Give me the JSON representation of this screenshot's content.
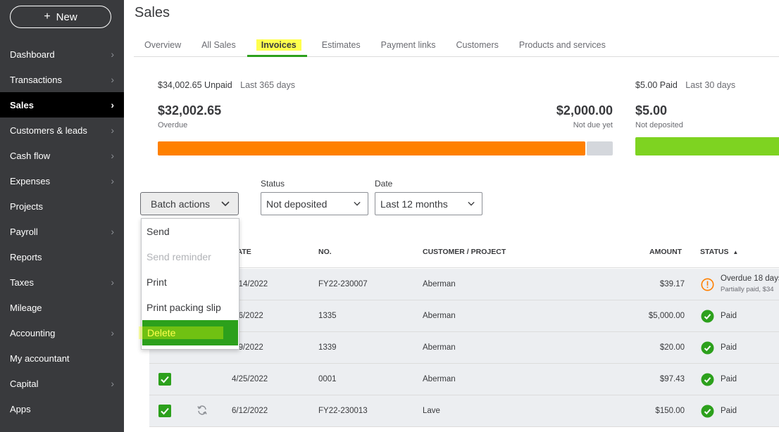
{
  "sidebar": {
    "new_label": "New",
    "items": [
      {
        "label": "Dashboard",
        "chevron": true
      },
      {
        "label": "Transactions",
        "chevron": true
      },
      {
        "label": "Sales",
        "chevron": true,
        "active": true
      },
      {
        "label": "Customers & leads",
        "chevron": true
      },
      {
        "label": "Cash flow",
        "chevron": true
      },
      {
        "label": "Expenses",
        "chevron": true
      },
      {
        "label": "Projects",
        "chevron": false
      },
      {
        "label": "Payroll",
        "chevron": true
      },
      {
        "label": "Reports",
        "chevron": false
      },
      {
        "label": "Taxes",
        "chevron": true
      },
      {
        "label": "Mileage",
        "chevron": false
      },
      {
        "label": "Accounting",
        "chevron": true
      },
      {
        "label": "My accountant",
        "chevron": false
      },
      {
        "label": "Capital",
        "chevron": true
      },
      {
        "label": "Apps",
        "chevron": false
      }
    ]
  },
  "header": {
    "title": "Sales",
    "tabs": [
      "Overview",
      "All Sales",
      "Invoices",
      "Estimates",
      "Payment links",
      "Customers",
      "Products and services"
    ],
    "active_tab": "Invoices"
  },
  "summary": {
    "unpaid": {
      "amount": "$34,002.65",
      "label": "Unpaid",
      "period": "Last 365 days"
    },
    "overdue": {
      "amount": "$32,002.65",
      "label": "Overdue"
    },
    "not_due": {
      "amount": "$2,000.00",
      "label": "Not due yet"
    },
    "overdue_fraction": 0.94,
    "paid": {
      "amount": "$5.00",
      "label": "Paid",
      "period": "Last 30 days"
    },
    "not_deposited": {
      "amount": "$5.00",
      "label": "Not deposited"
    }
  },
  "filters": {
    "batch_label": "Batch actions",
    "status_label": "Status",
    "status_value": "Not deposited",
    "date_label": "Date",
    "date_value": "Last 12 months"
  },
  "batch_menu": [
    "Send",
    "Send reminder",
    "Print",
    "Print packing slip",
    "Delete"
  ],
  "table": {
    "headers": {
      "date": "DATE",
      "no": "NO.",
      "customer": "CUSTOMER / PROJECT",
      "amount": "AMOUNT",
      "status": "STATUS",
      "sort_arrow": "▲"
    },
    "rows": [
      {
        "date": "4/14/2022",
        "no": "FY22-230007",
        "customer": "Aberman",
        "amount": "$39.17",
        "status": "Overdue 18 days",
        "substatus": "Partially paid, $34",
        "icon": "warning"
      },
      {
        "date": "5/6/2022",
        "no": "1335",
        "customer": "Aberman",
        "amount": "$5,000.00",
        "status": "Paid",
        "icon": "check"
      },
      {
        "date": "5/9/2022",
        "no": "1339",
        "customer": "Aberman",
        "amount": "$20.00",
        "status": "Paid",
        "icon": "check"
      },
      {
        "date": "4/25/2022",
        "no": "0001",
        "customer": "Aberman",
        "amount": "$97.43",
        "status": "Paid",
        "icon": "check"
      },
      {
        "date": "6/12/2022",
        "no": "FY22-230013",
        "customer": "Lave",
        "amount": "$150.00",
        "status": "Paid",
        "icon": "check",
        "recurring": true
      }
    ]
  },
  "colors": {
    "sidebar_bg": "#393a3d",
    "accent_green": "#2ca01c",
    "overdue_orange": "#ff8000",
    "paid_green": "#7ed321",
    "highlight_yellow": "#ffff4d"
  }
}
